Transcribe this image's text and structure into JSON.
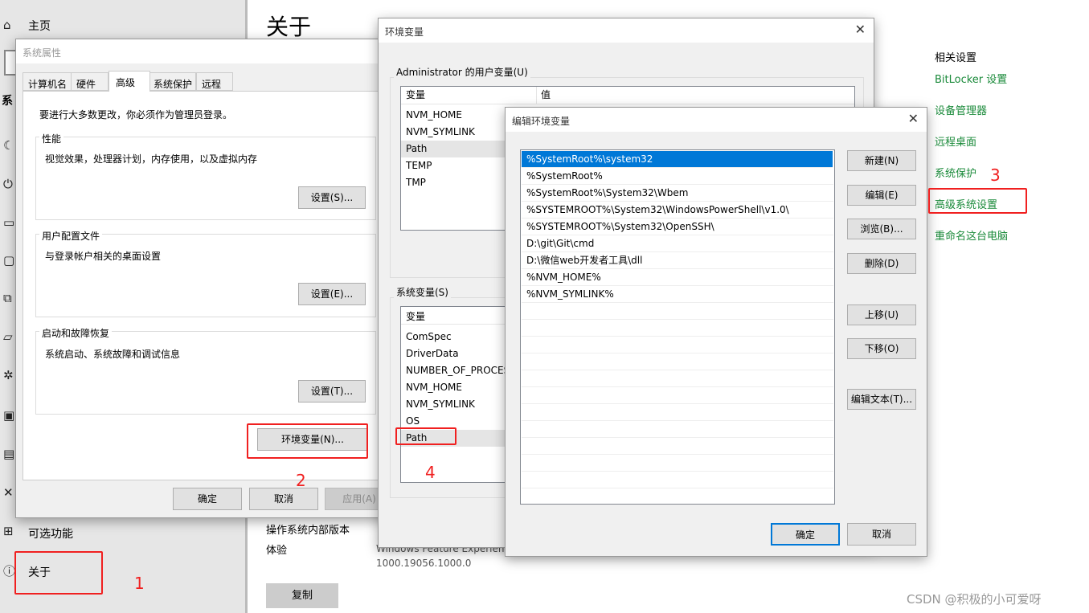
{
  "settings": {
    "home": "主页",
    "section_partial": "系",
    "optional_features": "可选功能",
    "about": "关于",
    "page_title": "关于",
    "os_build_label": "操作系统内部版本",
    "experience_label": "体验",
    "experience_value": "Windows Feature Experien",
    "experience_version": "1000.19056.1000.0",
    "copy_button": "复制",
    "related_title": "相关设置",
    "related_links": [
      "BitLocker 设置",
      "设备管理器",
      "远程桌面",
      "系统保护",
      "高级系统设置",
      "重命名这台电脑"
    ]
  },
  "sysprops": {
    "title": "系统属性",
    "tabs": [
      "计算机名",
      "硬件",
      "高级",
      "系统保护",
      "远程"
    ],
    "admin_note": "要进行大多数更改，你必须作为管理员登录。",
    "perf_label": "性能",
    "perf_desc": "视觉效果，处理器计划，内存使用，以及虚拟内存",
    "perf_btn": "设置(S)...",
    "profile_label": "用户配置文件",
    "profile_desc": "与登录帐户相关的桌面设置",
    "profile_btn": "设置(E)...",
    "startup_label": "启动和故障恢复",
    "startup_desc": "系统启动、系统故障和调试信息",
    "startup_btn": "设置(T)...",
    "env_btn": "环境变量(N)...",
    "ok": "确定",
    "cancel": "取消",
    "apply": "应用(A)"
  },
  "envvars": {
    "title": "环境变量",
    "user_label": "Administrator 的用户变量(U)",
    "col_var": "变量",
    "col_val": "值",
    "user_rows": [
      "NVM_HOME",
      "NVM_SYMLINK",
      "Path",
      "TEMP",
      "TMP"
    ],
    "sys_label": "系统变量(S)",
    "sys_rows": [
      "ComSpec",
      "DriverData",
      "NUMBER_OF_PROCES",
      "NVM_HOME",
      "NVM_SYMLINK",
      "OS",
      "Path"
    ]
  },
  "editenv": {
    "title": "编辑环境变量",
    "entries": [
      "%SystemRoot%\\system32",
      "%SystemRoot%",
      "%SystemRoot%\\System32\\Wbem",
      "%SYSTEMROOT%\\System32\\WindowsPowerShell\\v1.0\\",
      "%SYSTEMROOT%\\System32\\OpenSSH\\",
      "D:\\git\\Git\\cmd",
      "D:\\微信web开发者工具\\dll",
      "%NVM_HOME%",
      "%NVM_SYMLINK%"
    ],
    "buttons": [
      "新建(N)",
      "编辑(E)",
      "浏览(B)...",
      "删除(D)",
      "上移(U)",
      "下移(O)",
      "编辑文本(T)..."
    ],
    "ok": "确定",
    "cancel": "取消"
  },
  "annotations": [
    "1",
    "2",
    "3",
    "4"
  ],
  "watermark": "CSDN @积极的小可爱呀",
  "colors": {
    "link_green": "#1a8a3a",
    "selection_blue": "#0078d7",
    "annotation_red": "#f02020"
  }
}
